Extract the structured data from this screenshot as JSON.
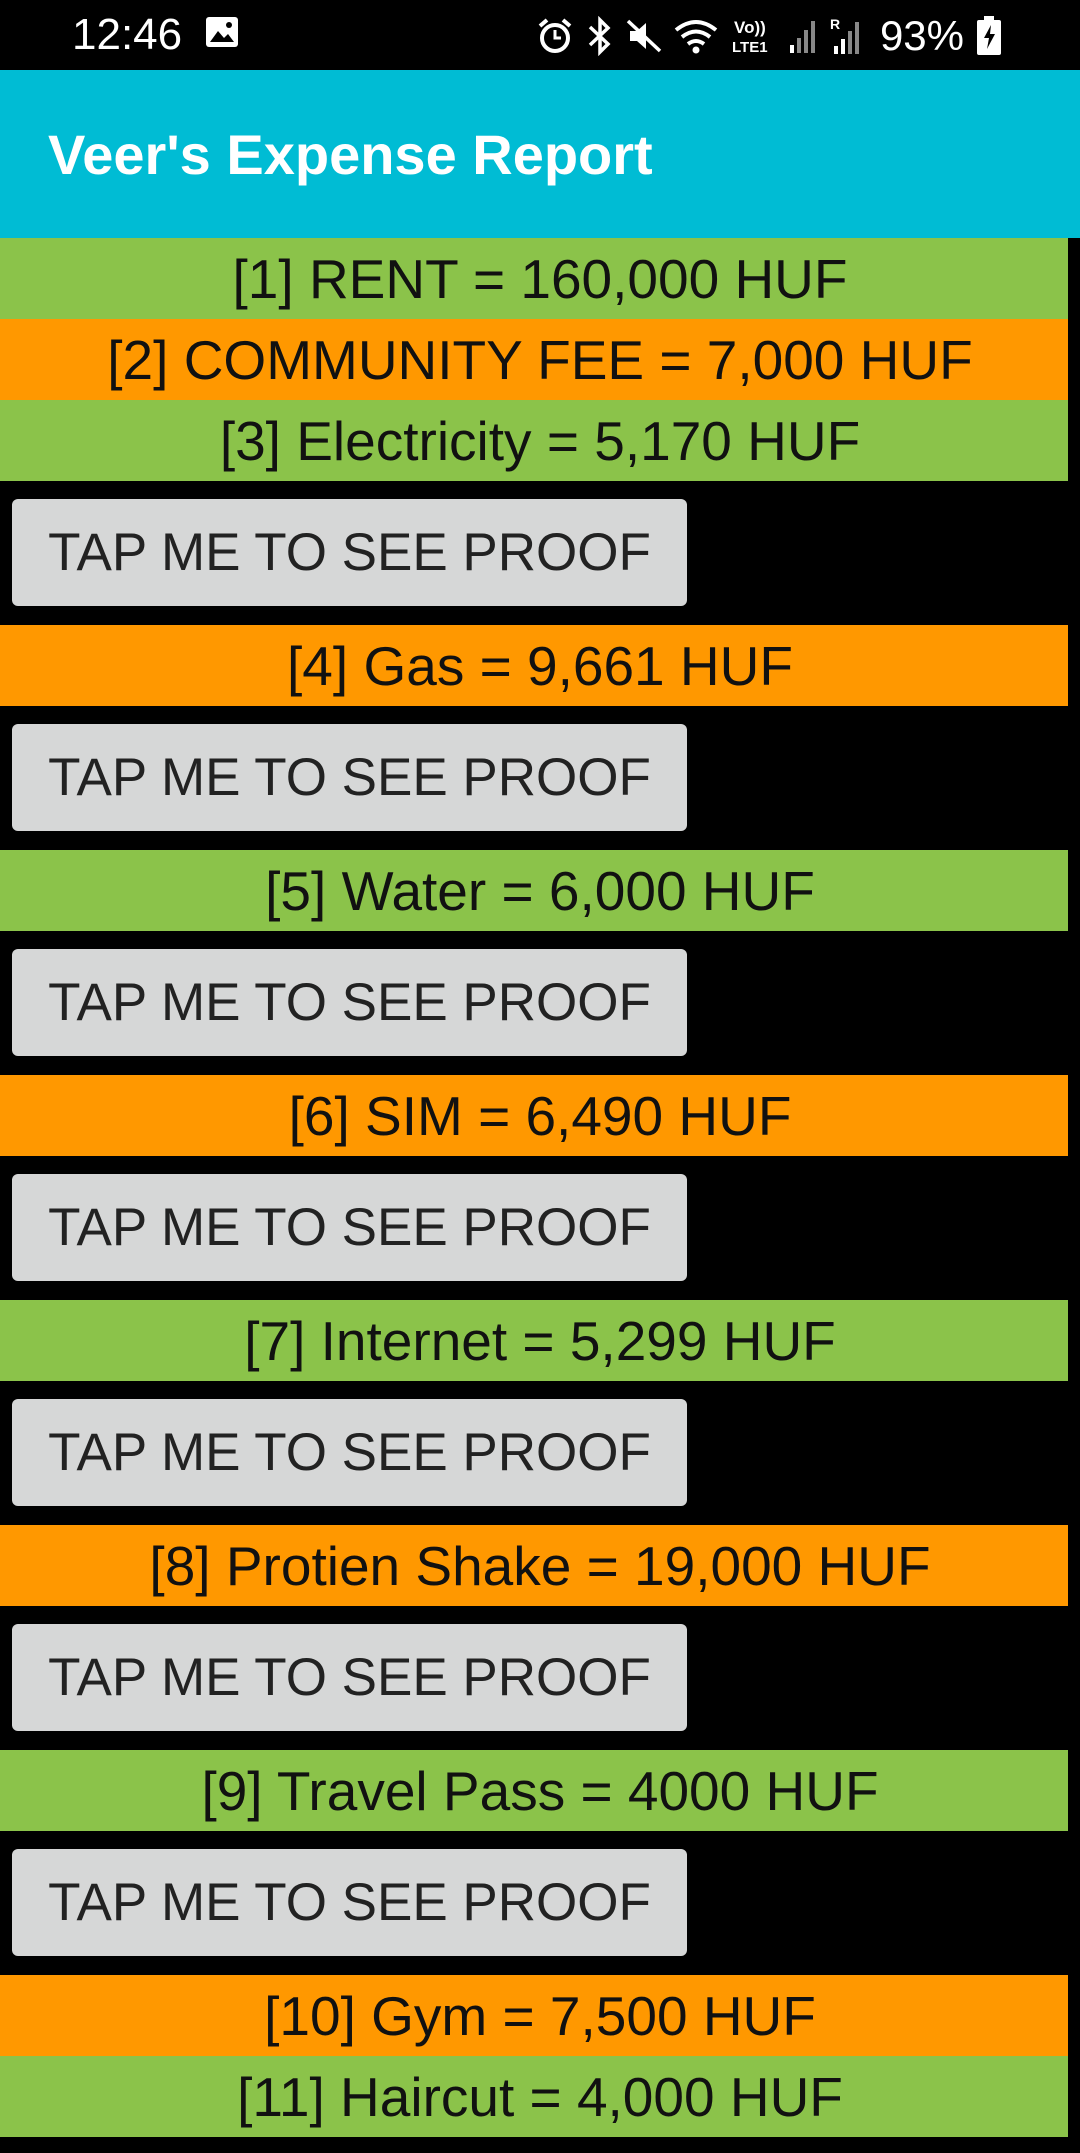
{
  "status_bar": {
    "time": "12:46",
    "battery": "93%",
    "icons": [
      "gallery-icon",
      "alarm-icon",
      "bluetooth-icon",
      "mute-icon",
      "wifi-icon",
      "volte-icon",
      "signal-icon",
      "roaming-signal-icon",
      "battery-charging-icon"
    ]
  },
  "app_bar": {
    "title": "Veer's Expense Report",
    "color": "#00BCD4"
  },
  "colors": {
    "green": "#8BC34A",
    "orange": "#FF9800",
    "button": "#D6D7D7"
  },
  "proof_button_label": "TAP ME TO SEE PROOF",
  "entries": [
    {
      "label": "[1] RENT = 160,000 HUF",
      "color": "green",
      "has_proof": false
    },
    {
      "label": "[2] COMMUNITY FEE = 7,000 HUF",
      "color": "orange",
      "has_proof": false
    },
    {
      "label": "[3] Electricity = 5,170 HUF",
      "color": "green",
      "has_proof": true
    },
    {
      "label": "[4] Gas = 9,661 HUF",
      "color": "orange",
      "has_proof": true
    },
    {
      "label": "[5] Water = 6,000 HUF",
      "color": "green",
      "has_proof": true
    },
    {
      "label": "[6] SIM = 6,490 HUF",
      "color": "orange",
      "has_proof": true
    },
    {
      "label": "[7] Internet = 5,299 HUF",
      "color": "green",
      "has_proof": true
    },
    {
      "label": "[8] Protien Shake = 19,000 HUF",
      "color": "orange",
      "has_proof": true
    },
    {
      "label": "[9] Travel Pass = 4000 HUF",
      "color": "green",
      "has_proof": true
    },
    {
      "label": "[10] Gym = 7,500 HUF",
      "color": "orange",
      "has_proof": false
    },
    {
      "label": "[11] Haircut = 4,000 HUF",
      "color": "green",
      "has_proof": false
    }
  ]
}
